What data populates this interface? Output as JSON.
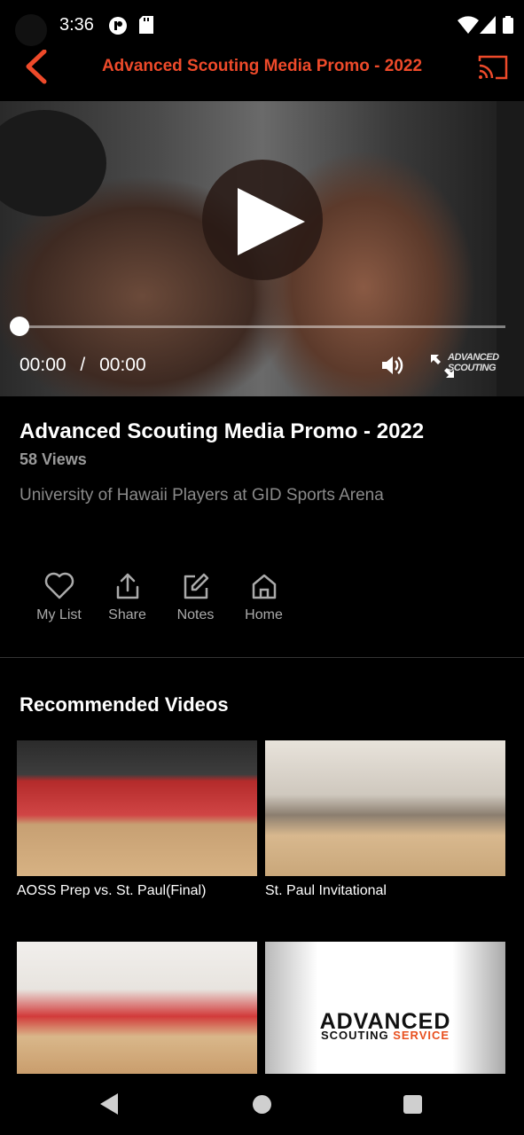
{
  "status_bar": {
    "time": "3:36"
  },
  "app_bar": {
    "title": "Advanced Scouting Media Promo - 2022"
  },
  "player": {
    "current_time": "00:00",
    "separator": "/",
    "duration": "00:00",
    "progress": 0,
    "watermark": "ADVANCED SCOUTING"
  },
  "video": {
    "title": "Advanced Scouting Media Promo - 2022",
    "views": "58 Views",
    "description": "University of Hawaii Players at GID Sports Arena"
  },
  "actions": [
    {
      "label": "My List",
      "icon": "heart-icon"
    },
    {
      "label": "Share",
      "icon": "share-icon"
    },
    {
      "label": "Notes",
      "icon": "edit-icon"
    },
    {
      "label": "Home",
      "icon": "home-icon"
    }
  ],
  "recommended": {
    "heading": "Recommended Videos",
    "items": [
      {
        "caption": "AOSS Prep vs. St. Paul(Final)"
      },
      {
        "caption": "St. Paul Invitational"
      },
      {
        "caption": ""
      },
      {
        "caption": ""
      }
    ],
    "brand_logo": {
      "line1": "ADVANCED",
      "line2a": "SCOUTING",
      "line2b": "SERVICE"
    }
  },
  "colors": {
    "accent": "#ee4a2a",
    "background": "#000000",
    "muted": "#8a8a8a"
  }
}
